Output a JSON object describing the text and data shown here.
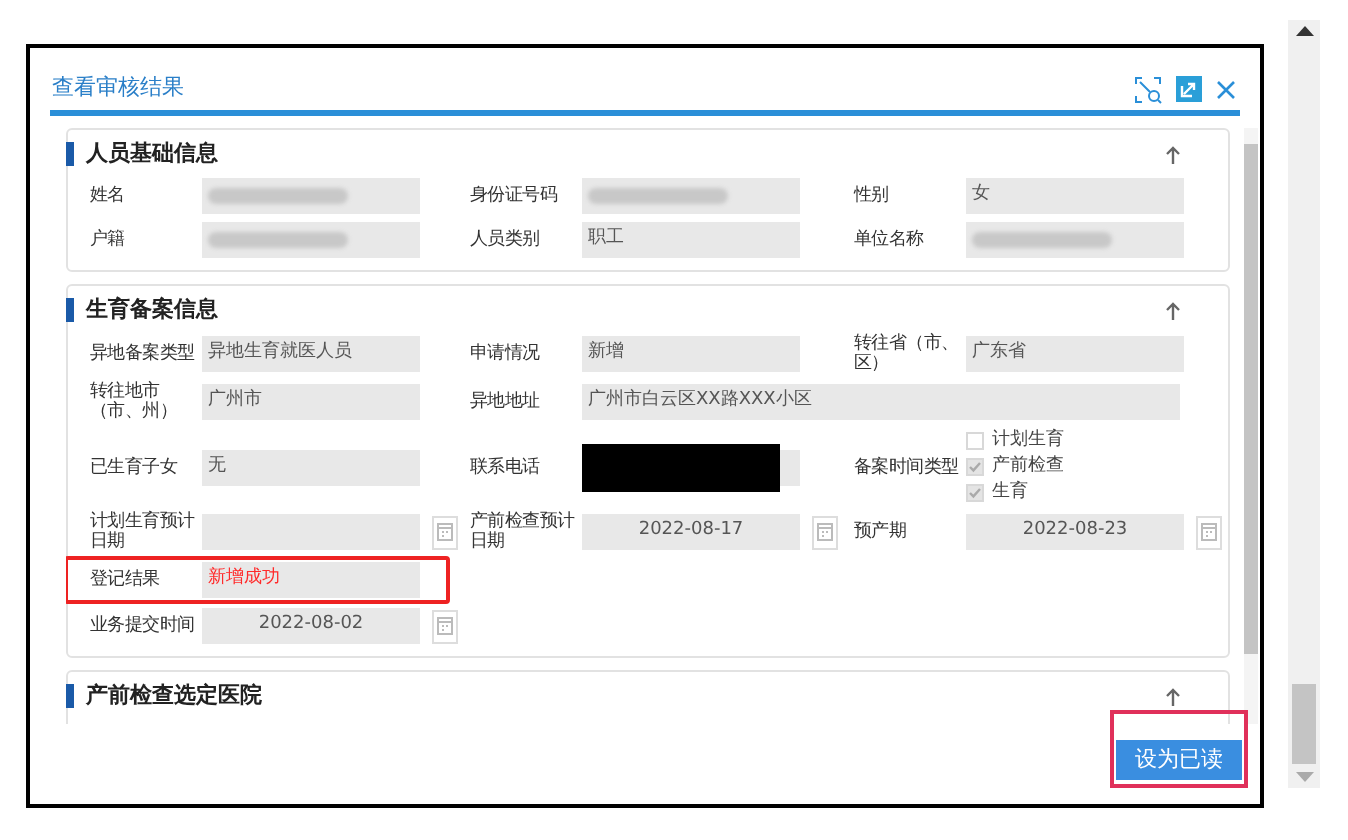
{
  "dialog": {
    "title": "查看审核结果"
  },
  "sections": [
    {
      "title": "人员基础信息",
      "fields": [
        {
          "label": "姓名",
          "kind": "blurred"
        },
        {
          "label": "身份证号码",
          "kind": "blurred"
        },
        {
          "label": "性别",
          "kind": "text",
          "value": "女"
        },
        {
          "label": "户籍",
          "kind": "blurred"
        },
        {
          "label": "人员类别",
          "kind": "text",
          "value": "职工"
        },
        {
          "label": "单位名称",
          "kind": "blurred"
        }
      ]
    },
    {
      "title": "生育备案信息",
      "fields": [
        {
          "label": "异地备案类型",
          "kind": "text",
          "value": "异地生育就医人员"
        },
        {
          "label": "申请情况",
          "kind": "text",
          "value": "新增"
        },
        {
          "label": "转往省（市、区）",
          "kind": "text",
          "value": "广东省"
        },
        {
          "label": "转往地市（市、州）",
          "kind": "text",
          "value": "广州市"
        },
        {
          "label": "异地地址",
          "kind": "wide",
          "value": "广州市白云区XX路XXX小区"
        },
        {
          "label": "已生育子女",
          "kind": "text",
          "value": "无"
        },
        {
          "label": "联系电话",
          "kind": "redacted"
        },
        {
          "label": "备案时间类型",
          "kind": "checkboxes",
          "options": [
            {
              "label": "计划生育",
              "checked": false
            },
            {
              "label": "产前检查",
              "checked": true
            },
            {
              "label": "生育",
              "checked": true
            }
          ]
        },
        {
          "label": "计划生育预计日期",
          "kind": "date"
        },
        {
          "label": "产前检查预计日期",
          "kind": "date",
          "value": "2022-08-17"
        },
        {
          "label": "预产期",
          "kind": "date",
          "value": "2022-08-23"
        },
        {
          "label": "登记结果",
          "kind": "text",
          "value": "新增成功",
          "color": "#ff2a2a",
          "highlighted": true
        },
        {
          "label": "业务提交时间",
          "kind": "date",
          "value": "2022-08-02"
        }
      ]
    },
    {
      "title": "产前检查选定医院"
    }
  ],
  "button": {
    "label": "设为已读",
    "highlighted": true
  }
}
